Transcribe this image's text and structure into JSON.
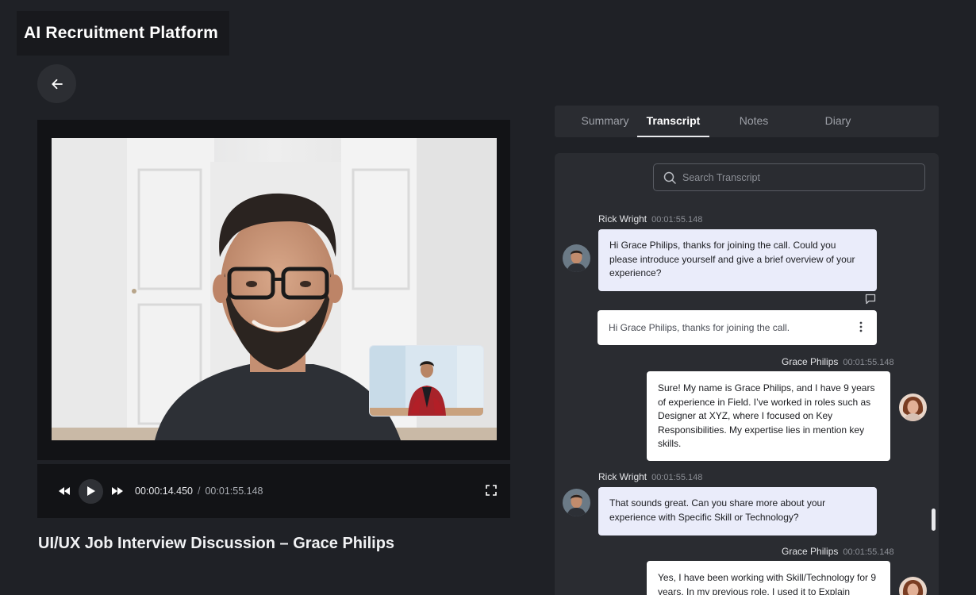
{
  "app": {
    "title": "AI Recruitment Platform"
  },
  "video": {
    "current_time": "00:00:14.450",
    "separator": "/",
    "total_time": "00:01:55.148",
    "title": "UI/UX Job Interview Discussion – Grace Philips"
  },
  "tabs": [
    {
      "label": "Summary",
      "active": false
    },
    {
      "label": "Transcript",
      "active": true
    },
    {
      "label": "Notes",
      "active": false
    },
    {
      "label": "Diary",
      "active": false
    }
  ],
  "search": {
    "placeholder": "Search Transcript"
  },
  "messages": [
    {
      "speaker": "Rick Wright",
      "timestamp": "00:01:55.148",
      "text": "Hi Grace Philips, thanks for joining the call. Could you please introduce yourself and give a brief overview of your experience?"
    },
    {
      "speaker": "Grace Philips",
      "timestamp": "00:01:55.148",
      "text": "Sure! My name is  Grace Philips, and I have 9 years of experience in Field. I’ve worked in roles such as Designer at XYZ, where I focused on Key Responsibilities. My expertise lies in mention key skills."
    },
    {
      "speaker": "Rick Wright",
      "timestamp": "00:01:55.148",
      "text": "That sounds great. Can you share more about your experience with Specific Skill or Technology?"
    },
    {
      "speaker": "Grace Philips",
      "timestamp": "00:01:55.148",
      "text": "Yes, I have been working with Skill/Technology for 9 years. In my previous role, I used it to Explain"
    }
  ],
  "reply_preview": {
    "text": "Hi Grace Philips, thanks for joining the call."
  },
  "colors": {
    "background": "#1f2126",
    "panel": "#2a2c31",
    "interviewer_bubble": "#eaecfa",
    "candidate_bubble": "#ffffff"
  }
}
